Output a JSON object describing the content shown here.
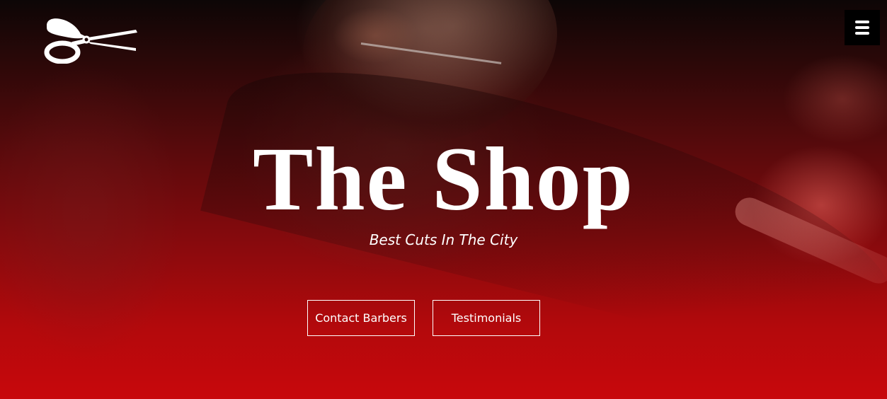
{
  "hero": {
    "title": "The Shop",
    "subtitle": "Best Cuts In The City",
    "buttons": [
      {
        "label": "Contact Barbers"
      },
      {
        "label": "Testimonials"
      }
    ]
  },
  "header": {
    "logo_icon": "scissors-icon",
    "menu_icon": "hamburger-menu-icon"
  },
  "colors": {
    "overlay_top": "#0d0606",
    "overlay_bottom": "#c8080c",
    "menu_background": "#000000",
    "text": "#ffffff"
  }
}
